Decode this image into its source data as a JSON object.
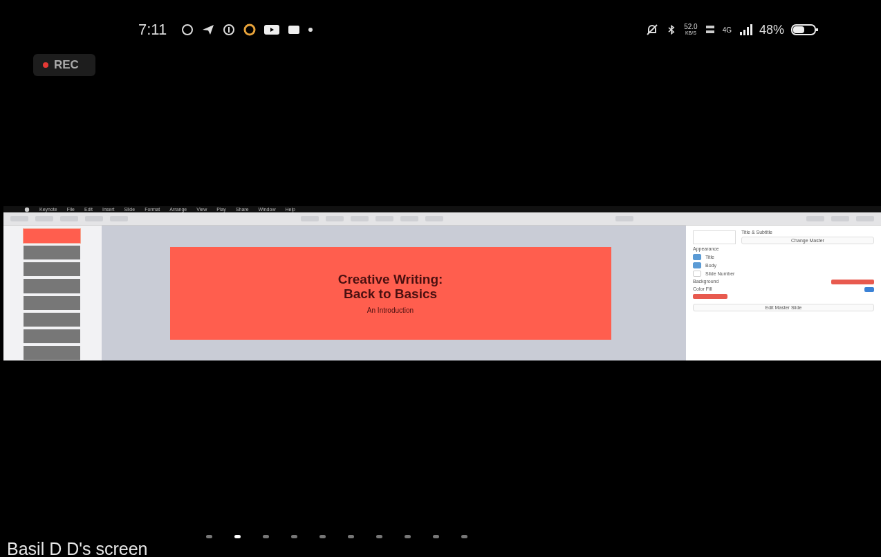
{
  "status_bar": {
    "time": "7:11",
    "speed_value": "52.0",
    "speed_unit": "KB/S",
    "network": "4G",
    "battery": "48%"
  },
  "recording": {
    "label": "REC"
  },
  "keynote": {
    "menu": [
      "Keynote",
      "File",
      "Edit",
      "Insert",
      "Slide",
      "Format",
      "Arrange",
      "View",
      "Play",
      "Share",
      "Window",
      "Help"
    ],
    "slides": [
      {
        "kind": "title",
        "selected": true
      },
      {
        "kind": "photo",
        "selected": false
      },
      {
        "kind": "photo",
        "selected": false
      },
      {
        "kind": "photo",
        "selected": false
      },
      {
        "kind": "photo",
        "selected": false
      },
      {
        "kind": "photo",
        "selected": false
      },
      {
        "kind": "photo",
        "selected": false
      },
      {
        "kind": "photo",
        "selected": false
      }
    ],
    "slide": {
      "title": "Creative Writing:",
      "title_line_2": "Back to Basics",
      "subtitle": "An Introduction"
    },
    "inspector": {
      "master": "Title & Subtitle",
      "change_master": "Change Master",
      "appearance": "Appearance",
      "options": [
        {
          "label": "Title",
          "checked": true
        },
        {
          "label": "Body",
          "checked": true
        },
        {
          "label": "Slide Number",
          "checked": false
        }
      ],
      "background": "Background",
      "fill": "Color Fill",
      "edit_master": "Edit Master Slide"
    }
  },
  "page_dots": [
    {
      "selected": false
    },
    {
      "selected": true
    },
    {
      "selected": false
    },
    {
      "selected": false
    },
    {
      "selected": false
    },
    {
      "selected": false
    },
    {
      "selected": false
    },
    {
      "selected": false
    },
    {
      "selected": false
    },
    {
      "selected": false
    }
  ],
  "footer": {
    "label": "Basil D D's screen"
  }
}
